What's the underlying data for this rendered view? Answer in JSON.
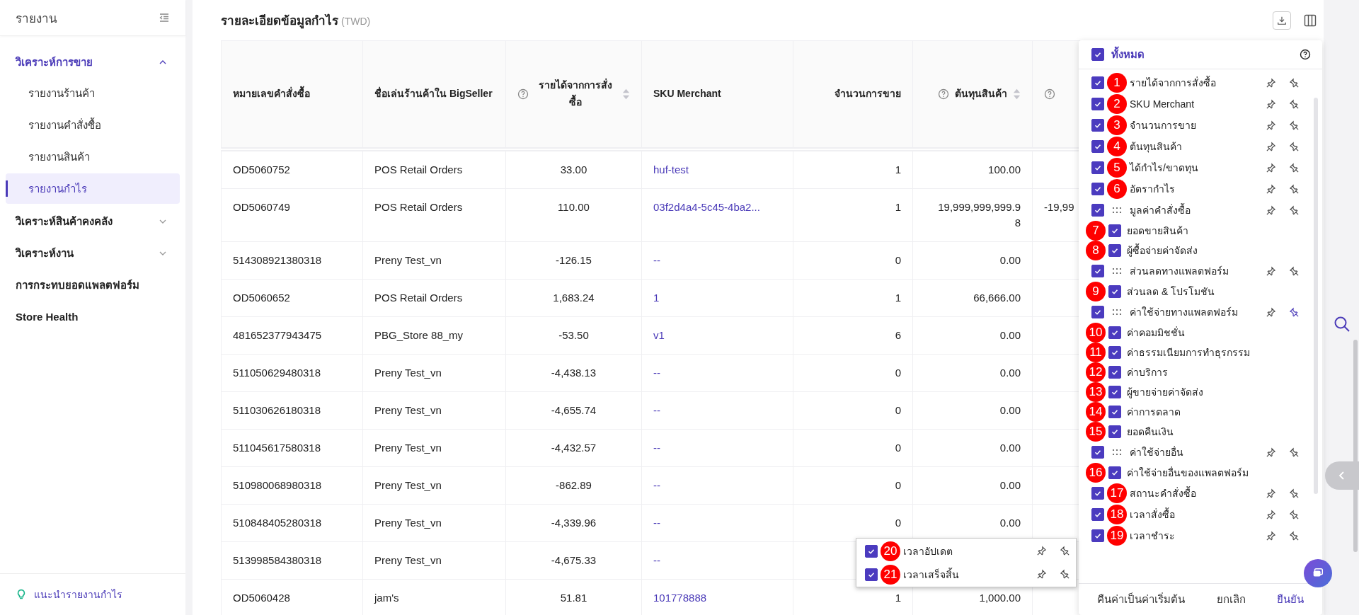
{
  "sidebar": {
    "title": "รายงาน",
    "groups": [
      {
        "label": "วิเคราะห์การขาย",
        "expanded": true,
        "children": [
          {
            "label": "รายงานร้านค้า",
            "selected": false
          },
          {
            "label": "รายงานคำสั่งซื้อ",
            "selected": false
          },
          {
            "label": "รายงานสินค้า",
            "selected": false
          },
          {
            "label": "รายงานกำไร",
            "selected": true
          }
        ]
      },
      {
        "label": "วิเคราะห์สินค้าคงคลัง",
        "expanded": false
      },
      {
        "label": "วิเคราะห์งาน",
        "expanded": false
      },
      {
        "label": "การกระทบยอดแพลตฟอร์ม"
      },
      {
        "label": "Store Health"
      }
    ],
    "footer_link": "แนะนำรายงานกำไร"
  },
  "report": {
    "title": "รายละเอียดข้อมูลกำไร",
    "currency": "(TWD)",
    "table": {
      "columns": [
        {
          "label": "หมายเลขคำสั่งซื้อ",
          "help": false,
          "sortable": false
        },
        {
          "label": "ชื่อเล่นร้านค้าใน BigSeller",
          "help": false,
          "sortable": false
        },
        {
          "label": "รายได้จากการสั่งซื้อ",
          "help": true,
          "sortable": true
        },
        {
          "label": "SKU Merchant",
          "help": false,
          "sortable": false
        },
        {
          "label": "จำนวนการขาย",
          "help": false,
          "sortable": false
        },
        {
          "label": "ต้นทุนสินค้า",
          "help": true,
          "sortable": true
        },
        {
          "help": true,
          "sortable": false
        }
      ],
      "rows": [
        [
          "OD5060752",
          "POS Retail Orders",
          "33.00",
          "huf-test",
          "1",
          "100.00"
        ],
        [
          "OD5060749",
          "POS Retail Orders",
          "110.00",
          "03f2d4a4-5c45-4ba2...",
          "1",
          "19,999,999,999.98",
          "-19,99"
        ],
        [
          "514308921380318",
          "Preny Test_vn",
          "-126.15",
          "--",
          "0",
          "0.00"
        ],
        [
          "OD5060652",
          "POS Retail Orders",
          "1,683.24",
          "1",
          "1",
          "66,666.00"
        ],
        [
          "481652377943475",
          "PBG_Store 88_my",
          "-53.50",
          "v1",
          "6",
          "0.00"
        ],
        [
          "511050629480318",
          "Preny Test_vn",
          "-4,438.13",
          "--",
          "0",
          "0.00"
        ],
        [
          "511030626180318",
          "Preny Test_vn",
          "-4,655.74",
          "--",
          "0",
          "0.00"
        ],
        [
          "511045617580318",
          "Preny Test_vn",
          "-4,432.57",
          "--",
          "0",
          "0.00"
        ],
        [
          "510980068980318",
          "Preny Test_vn",
          "-862.89",
          "--",
          "0",
          "0.00"
        ],
        [
          "510848405280318",
          "Preny Test_vn",
          "-4,339.96",
          "--",
          "0",
          "0.00"
        ],
        [
          "513998584380318",
          "Preny Test_vn",
          "-4,675.33",
          "--"
        ],
        [
          "OD5060428",
          "jam's",
          "51.81",
          "101778888",
          "1",
          "1,000.00"
        ]
      ]
    }
  },
  "column_panel": {
    "all": {
      "label": "ทั้งหมด",
      "checked": true
    },
    "items": [
      {
        "badge": "1",
        "label": "รายได้จากการสั่งซื้อ",
        "checked": true,
        "pin_left": false,
        "pin_right": false
      },
      {
        "badge": "2",
        "label": "SKU Merchant",
        "checked": true,
        "pin_left": false,
        "pin_right": false
      },
      {
        "badge": "3",
        "label": "จำนวนการขาย",
        "checked": true,
        "pin_left": false,
        "pin_right": false
      },
      {
        "badge": "4",
        "label": "ต้นทุนสินค้า",
        "checked": true,
        "pin_left": false,
        "pin_right": false
      },
      {
        "badge": "5",
        "label": "ได้กำไร/ขาดทุน",
        "checked": true,
        "pin_left": false,
        "pin_right": false
      },
      {
        "badge": "6",
        "label": "อัตรากำไร",
        "checked": true,
        "pin_left": false,
        "pin_right": false
      },
      {
        "label": "มูลค่าคำสั่งซื้อ",
        "checked": true,
        "pin_left": false,
        "pin_right": false,
        "children": [
          {
            "badge": "7",
            "label": "ยอดขายสินค้า",
            "checked": true
          },
          {
            "badge": "8",
            "label": "ผู้ซื้อจ่ายค่าจัดส่ง",
            "checked": true
          }
        ]
      },
      {
        "label": "ส่วนลดทางแพลตฟอร์ม",
        "checked": true,
        "pin_left": false,
        "pin_right": false,
        "children": [
          {
            "badge": "9",
            "label": "ส่วนลด & โปรโมชัน",
            "checked": true
          }
        ]
      },
      {
        "label": "ค่าใช้จ่ายทางแพลตฟอร์ม",
        "checked": true,
        "pin_left": false,
        "pin_right": true,
        "children": [
          {
            "badge": "10",
            "label": "ค่าคอมมิชชั่น",
            "checked": true
          },
          {
            "badge": "11",
            "label": "ค่าธรรมเนียมการทำธุรกรรม",
            "checked": true
          },
          {
            "badge": "12",
            "label": "ค่าบริการ",
            "checked": true
          },
          {
            "badge": "13",
            "label": "ผู้ขายจ่ายค่าจัดส่ง",
            "checked": true
          },
          {
            "badge": "14",
            "label": "ค่าการตลาด",
            "checked": true
          },
          {
            "badge": "15",
            "label": "ยอดคืนเงิน",
            "checked": true
          }
        ]
      },
      {
        "label": "ค่าใช้จ่ายอื่น",
        "checked": true,
        "pin_left": false,
        "pin_right": false,
        "children": [
          {
            "badge": "16",
            "label": "ค่าใช้จ่ายอื่นของแพลตฟอร์ม",
            "checked": true
          }
        ]
      },
      {
        "badge": "17",
        "label": "สถานะคำสั่งซื้อ",
        "checked": true,
        "pin_left": false,
        "pin_right": false
      },
      {
        "badge": "18",
        "label": "เวลาสั่งซื้อ",
        "checked": true,
        "pin_left": false,
        "pin_right": false
      },
      {
        "badge": "19",
        "label": "เวลาชำระ",
        "checked": true,
        "pin_left": false,
        "pin_right": false
      }
    ],
    "buttons": [
      "คืนค่าเป็นค่าเริ่มต้น",
      "ยกเลิก",
      "ยืนยัน"
    ]
  },
  "dragged_items": [
    {
      "badge": "20",
      "label": "เวลาอัปเดต",
      "checked": true,
      "pin_left": false,
      "pin_right": false
    },
    {
      "badge": "21",
      "label": "เวลาเสร็จสิ้น",
      "checked": true,
      "pin_left": false,
      "pin_right": false
    }
  ]
}
